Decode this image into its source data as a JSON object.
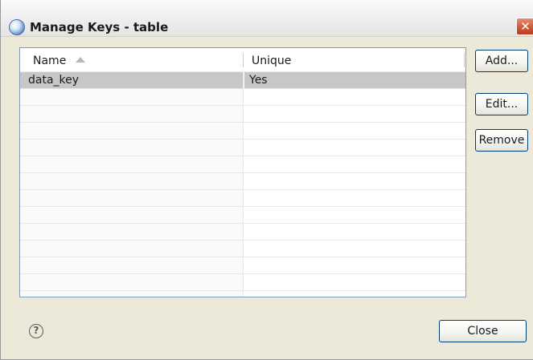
{
  "window": {
    "title": "Manage Keys - table",
    "close_glyph": "✕",
    "icon": "app-globe-icon"
  },
  "table": {
    "columns": [
      {
        "label": "Name",
        "sorted": "ascending"
      },
      {
        "label": "Unique"
      }
    ],
    "rows": [
      {
        "name": "data_key",
        "unique": "Yes",
        "selected": true
      },
      {
        "name": "",
        "unique": ""
      },
      {
        "name": "",
        "unique": ""
      },
      {
        "name": "",
        "unique": ""
      },
      {
        "name": "",
        "unique": ""
      },
      {
        "name": "",
        "unique": ""
      },
      {
        "name": "",
        "unique": ""
      },
      {
        "name": "",
        "unique": ""
      },
      {
        "name": "",
        "unique": ""
      },
      {
        "name": "",
        "unique": ""
      },
      {
        "name": "",
        "unique": ""
      },
      {
        "name": "",
        "unique": ""
      },
      {
        "name": "",
        "unique": ""
      },
      {
        "name": "",
        "unique": ""
      }
    ]
  },
  "buttons": {
    "add": "Add...",
    "edit": "Edit...",
    "remove": "Remove",
    "close": "Close"
  },
  "help": {
    "glyph": "?"
  }
}
